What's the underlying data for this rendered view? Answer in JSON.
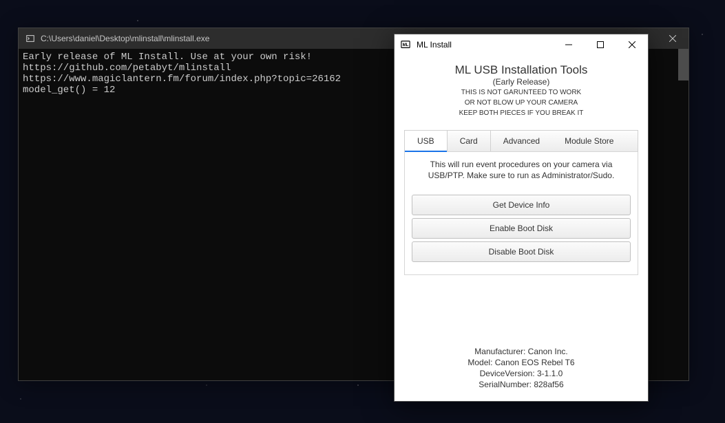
{
  "terminal": {
    "title": "C:\\Users\\daniel\\Desktop\\mlinstall\\mlinstall.exe",
    "lines": [
      "Early release of ML Install. Use at your own risk!",
      "https://github.com/petabyt/mlinstall",
      "https://www.magiclantern.fm/forum/index.php?topic=26162",
      "model_get() = 12"
    ]
  },
  "ml": {
    "window_title": "ML Install",
    "heading": "ML USB Installation Tools",
    "subtitle": "(Early Release)",
    "warning_lines": [
      "THIS IS NOT GARUNTEED TO WORK",
      "OR NOT BLOW UP YOUR CAMERA",
      "KEEP BOTH PIECES IF YOU BREAK IT"
    ],
    "tabs": {
      "usb": "USB",
      "card": "Card",
      "advanced": "Advanced",
      "module_store": "Module Store"
    },
    "usb_desc": "This will run event procedures on your camera via USB/PTP. Make sure to run as Administrator/Sudo.",
    "buttons": {
      "get_info": "Get Device Info",
      "enable_boot": "Enable Boot Disk",
      "disable_boot": "Disable Boot Disk"
    },
    "device": {
      "manufacturer": "Manufacturer: Canon Inc.",
      "model": "Model: Canon EOS Rebel T6",
      "device_version": "DeviceVersion: 3-1.1.0",
      "serial": "SerialNumber: 828af56"
    }
  }
}
